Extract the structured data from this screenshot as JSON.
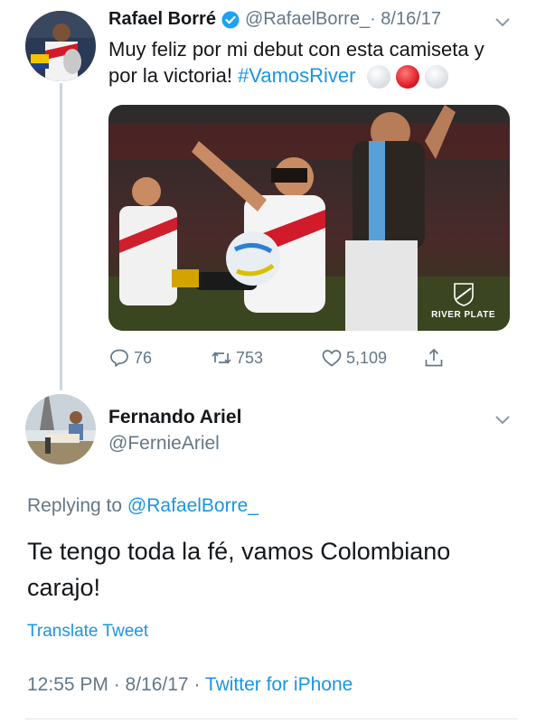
{
  "tweet1": {
    "name": "Rafael Borré",
    "handle": "@RafaelBorre_",
    "date": "· 8/16/17",
    "text": "Muy feliz por mi debut con esta camiseta y por la victoria! ",
    "hashtag": "#VamosRiver",
    "emojis": [
      "white-circle",
      "red-circle",
      "white-circle"
    ],
    "media_watermark": "RIVER PLATE",
    "actions": {
      "replies": "76",
      "retweets": "753",
      "likes": "5,109"
    }
  },
  "tweet2": {
    "name": "Fernando Ariel",
    "handle": "@FernieAriel",
    "replying_prefix": "Replying to ",
    "replying_mention": "@RafaelBorre_",
    "text": "Te tengo toda la fé, vamos Colombiano carajo!",
    "translate": "Translate Tweet",
    "time": "12:55 PM · 8/16/17 · ",
    "source": "Twitter for iPhone"
  },
  "colors": {
    "link": "#1b95e0",
    "muted": "#657786",
    "text": "#14171a",
    "thread_line": "#ccd6dd"
  }
}
